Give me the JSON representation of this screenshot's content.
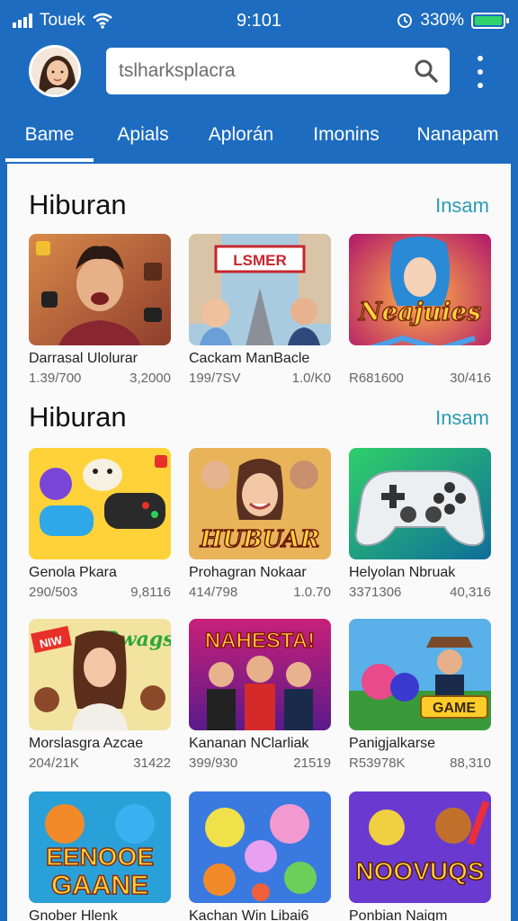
{
  "status": {
    "carrier": "Touek",
    "time": "9:101",
    "battery": "330%",
    "battery_color": "#2fd36a"
  },
  "search": {
    "value": "tslharksplacra"
  },
  "tabs": [
    {
      "label": "Bame"
    },
    {
      "label": "Apials"
    },
    {
      "label": "Aplorán"
    },
    {
      "label": "Imonins"
    },
    {
      "label": "Nanapam"
    }
  ],
  "sections": [
    {
      "title": "Hiburan",
      "more": "Insam"
    },
    {
      "title": "Hiburan",
      "more": "Insam"
    }
  ],
  "cards": [
    {
      "name": "Darrasal Ulolurar",
      "left": "1.39/700",
      "right": "3,2000",
      "thumb_text": ""
    },
    {
      "name": "Cackam ManBacle",
      "left": "199/7SV",
      "right": "1.0/K0",
      "thumb_text": "LSMER"
    },
    {
      "name": "",
      "left": "R681600",
      "right": "30/416",
      "thumb_text": "Neajuies"
    },
    {
      "name": "Genola Pkara",
      "left": "290/503",
      "right": "9,8116",
      "thumb_text": ""
    },
    {
      "name": "Prohagran Nokaar",
      "left": "414/798",
      "right": "1.0.70",
      "thumb_text": "HUBUAR"
    },
    {
      "name": "Helyolan Nbruak",
      "left": "3371306",
      "right": "40,316",
      "thumb_text": ""
    },
    {
      "name": "Morslasgra Azcae",
      "left": "204/21K",
      "right": "31422",
      "thumb_text": "Rwags"
    },
    {
      "name": "Kananan NClarliak",
      "left": "399/930",
      "right": "21519",
      "thumb_text": "NAHESTA!"
    },
    {
      "name": "Panigjalkarse",
      "left": "R53978K",
      "right": "88,310",
      "thumb_text": "GAME"
    },
    {
      "name": "Gnober Hlenk",
      "left": "",
      "right": "",
      "thumb_text": "EENOOE GAANE"
    },
    {
      "name": "Kachan Win Libai6",
      "left": "",
      "right": "",
      "thumb_text": ""
    },
    {
      "name": "Ponbian Naigm",
      "left": "",
      "right": "",
      "thumb_text": "NOOVUQS"
    }
  ]
}
